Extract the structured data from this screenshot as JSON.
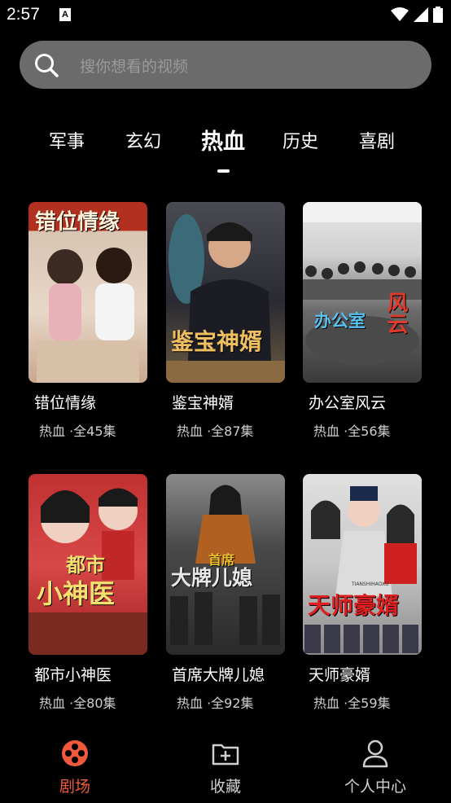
{
  "status_bar": {
    "time": "2:57",
    "notification_letter": "A"
  },
  "search": {
    "placeholder": "搜你想看的视频"
  },
  "tabs": [
    {
      "label": "军事",
      "active": false
    },
    {
      "label": "玄幻",
      "active": false
    },
    {
      "label": "热血",
      "active": true
    },
    {
      "label": "历史",
      "active": false
    },
    {
      "label": "喜剧",
      "active": false
    }
  ],
  "cards": [
    {
      "title": "错位情缘",
      "meta": "热血 ·全45集",
      "poster_text": "错位情缘",
      "palette": [
        "#c9a890",
        "#e8d7c8"
      ]
    },
    {
      "title": "鉴宝神婿",
      "meta": "热血 ·全87集",
      "poster_text": "鉴宝神婿",
      "palette": [
        "#2a2a33",
        "#7a6a50"
      ]
    },
    {
      "title": "办公室风云",
      "meta": "热血 ·全56集",
      "poster_text_1": "办公室",
      "poster_text_2": "风云",
      "palette": [
        "#dcdcdc",
        "#6b6b6b"
      ]
    },
    {
      "title": "都市小神医",
      "meta": "热血 ·全80集",
      "poster_text_1": "都市",
      "poster_text_2": "小神医",
      "palette": [
        "#b73030",
        "#e8b8b8"
      ]
    },
    {
      "title": "首席大牌儿媳",
      "meta": "热血 ·全92集",
      "poster_text_1": "首席",
      "poster_text_2": "大牌儿媳",
      "palette": [
        "#3a3a3a",
        "#8a7a6a"
      ]
    },
    {
      "title": "天师豪婿",
      "meta": "热血 ·全59集",
      "poster_text": "天师豪婿",
      "poster_subtext": "TIANSHIHAOXU",
      "palette": [
        "#d8d8d8",
        "#5a6a8a"
      ]
    }
  ],
  "bottom_nav": [
    {
      "label": "剧场",
      "icon": "film-reel-icon",
      "active": true
    },
    {
      "label": "收藏",
      "icon": "add-folder-icon",
      "active": false
    },
    {
      "label": "个人中心",
      "icon": "person-icon",
      "active": false
    }
  ],
  "colors": {
    "accent": "#f05a3a",
    "background": "#000000",
    "search_bg": "#6b6b6b"
  }
}
